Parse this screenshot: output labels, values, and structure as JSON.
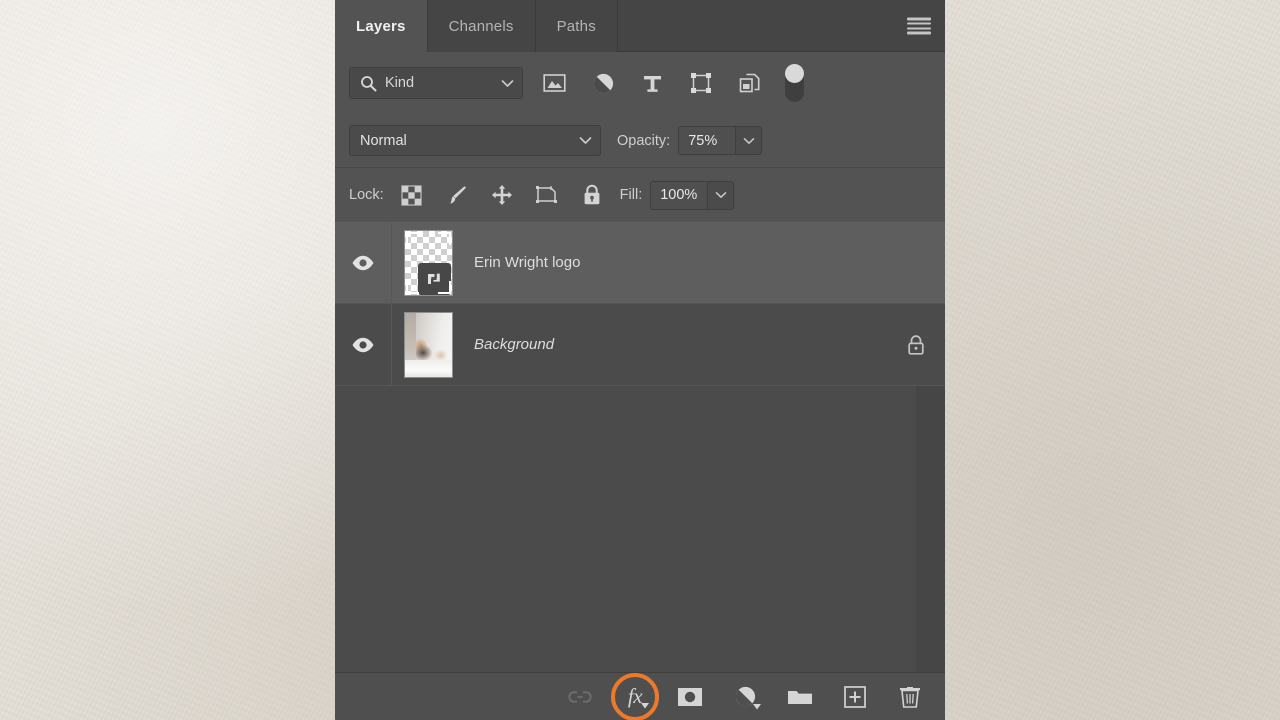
{
  "app": {
    "panel_title": "Layers",
    "theme_accent": "#ec7a2d",
    "panel_bg": "#535353",
    "list_bg": "#4b4b4b",
    "selected_row_bg": "#5e5e5e"
  },
  "tabs": [
    {
      "label": "Layers",
      "active": true
    },
    {
      "label": "Channels",
      "active": false
    },
    {
      "label": "Paths",
      "active": false
    }
  ],
  "panel_menu": {
    "icon": "hamburger-menu-icon"
  },
  "filter_bar": {
    "search_icon": "search-icon",
    "kind_label": "Kind",
    "kind_chevron": "chevron-down-icon",
    "filters": [
      {
        "name": "pixel-layers-filter",
        "icon": "image-icon"
      },
      {
        "name": "adjustment-layers-filter",
        "icon": "adjustment-half-circle-icon"
      },
      {
        "name": "type-layers-filter",
        "icon": "type-t-icon"
      },
      {
        "name": "shape-layers-filter",
        "icon": "shape-bounding-box-icon"
      },
      {
        "name": "smart-object-filter",
        "icon": "smart-object-icon"
      }
    ],
    "toggle": {
      "name": "filter-enable-toggle",
      "state": "on"
    }
  },
  "blend_bar": {
    "blend_mode": "Normal",
    "blend_chevron": "chevron-down-icon",
    "opacity_label": "Opacity:",
    "opacity_value": "75%",
    "opacity_chevron": "chevron-down-icon"
  },
  "lock_bar": {
    "lock_label": "Lock:",
    "lock_buttons": [
      {
        "name": "lock-transparent-pixels",
        "icon": "checkerboard-icon"
      },
      {
        "name": "lock-image-pixels",
        "icon": "paintbrush-icon"
      },
      {
        "name": "lock-position",
        "icon": "move-arrows-icon"
      },
      {
        "name": "lock-artboard-nesting",
        "icon": "artboard-icon"
      },
      {
        "name": "lock-all",
        "icon": "padlock-icon"
      }
    ],
    "fill_label": "Fill:",
    "fill_value": "100%",
    "fill_chevron": "chevron-down-icon"
  },
  "layers": [
    {
      "name": "Erin Wright logo",
      "selected": true,
      "visible": true,
      "italic": false,
      "locked": false,
      "thumbnail": "transparent-checkerboard-logo-thumbnail"
    },
    {
      "name": "Background",
      "selected": false,
      "visible": true,
      "italic": true,
      "locked": true,
      "thumbnail": "photo-thumbnail"
    }
  ],
  "bottom_toolbar": {
    "buttons": [
      {
        "name": "link-layers-button",
        "icon": "link-icon",
        "label": "",
        "disabled": true,
        "highlighted": false
      },
      {
        "name": "layer-style-fx-button",
        "icon": "fx-icon",
        "label": "fx",
        "disabled": false,
        "highlighted": true
      },
      {
        "name": "add-layer-mask-button",
        "icon": "layer-mask-icon",
        "label": "",
        "disabled": false,
        "highlighted": false
      },
      {
        "name": "new-adjustment-layer-button",
        "icon": "adjustment-half-circle-icon",
        "label": "",
        "disabled": false,
        "highlighted": false
      },
      {
        "name": "new-group-button",
        "icon": "folder-icon",
        "label": "",
        "disabled": false,
        "highlighted": false
      },
      {
        "name": "new-layer-button",
        "icon": "plus-square-icon",
        "label": "",
        "disabled": false,
        "highlighted": false
      },
      {
        "name": "delete-layer-button",
        "icon": "trash-icon",
        "label": "",
        "disabled": false,
        "highlighted": false
      }
    ]
  }
}
